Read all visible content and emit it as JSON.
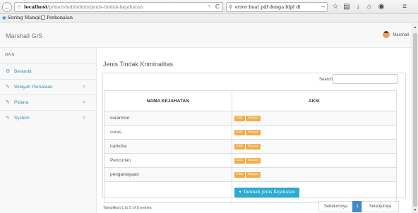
{
  "browser": {
    "back_icon": "back-arrow",
    "url_host": "localhost",
    "url_path": "/p/marshall/admin/jenis-tindak-kejahatan",
    "url_drop": "▽",
    "url_reload": "C",
    "search_text": "error buat pdf denga fdpf di",
    "search_go": "→",
    "toolbar_icons": [
      "star-icon",
      "clipboard-icon",
      "download-icon",
      "home-icon",
      "chat-icon",
      "menu-icon"
    ]
  },
  "bookmarks": [
    {
      "label": "Sering Mampir",
      "icon": "firefox-icon"
    },
    {
      "label": "Perkenalan",
      "icon": "folder-icon"
    }
  ],
  "header": {
    "brand": "Marshall GIS",
    "user": "Marshall"
  },
  "sidebar": {
    "section": "MAIN",
    "items": [
      {
        "label": "Beranda",
        "icon": "dashboard-icon",
        "has_chevron": false
      },
      {
        "label": "Wilayah Pemataan",
        "icon": "edit-icon",
        "has_chevron": true
      },
      {
        "label": "Pidana",
        "icon": "edit-icon",
        "has_chevron": true
      },
      {
        "label": "System",
        "icon": "edit-icon",
        "has_chevron": true
      }
    ],
    "chevron": "<"
  },
  "main": {
    "title": "Jenis Tindak Kriminalitas",
    "search_label": "Search:",
    "search_value": "",
    "columns": [
      "NAMA KEJAHATAN",
      "AKSI"
    ],
    "rows": [
      {
        "name": "curanmor"
      },
      {
        "name": "curas"
      },
      {
        "name": "narkoba"
      },
      {
        "name": "Pencurian"
      },
      {
        "name": "penganiayaan"
      }
    ],
    "edit_label": "Edit",
    "delete_label": "Hapus",
    "add_label": "Tambah Jenis Kejahatan",
    "info": "Tampilkan 1 to 5 of 5 entries",
    "pager": {
      "prev": "Sebelumnya",
      "current": "1",
      "next": "Selanjutnya"
    }
  },
  "colors": {
    "accent": "#3c8dbc",
    "warning_button": "#f0ad4e",
    "info_button": "#2aabd2",
    "pager_active": "#428bca"
  }
}
